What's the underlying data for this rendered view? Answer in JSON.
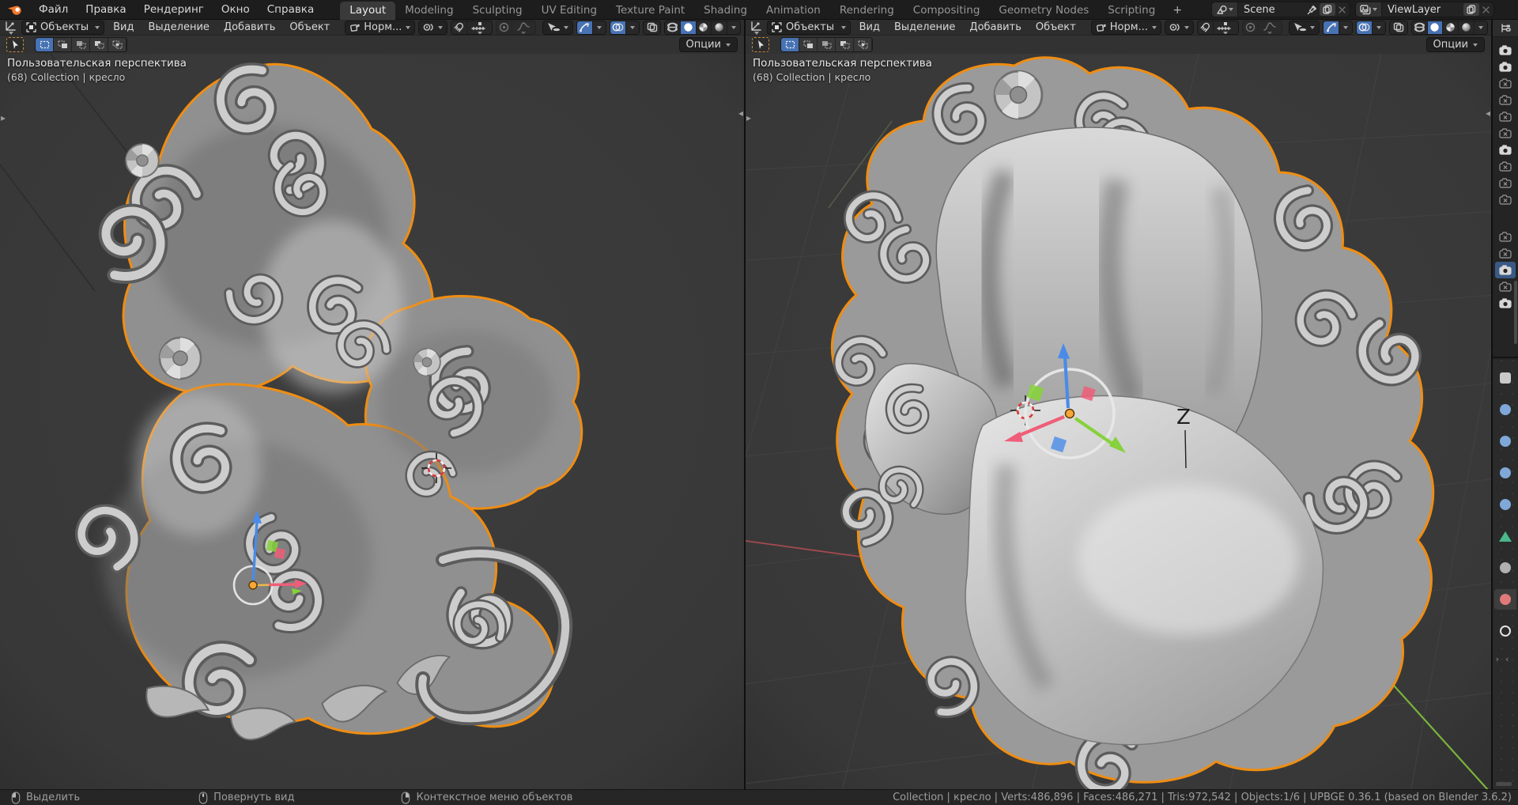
{
  "topbar": {
    "menus": [
      "Файл",
      "Правка",
      "Рендеринг",
      "Окно",
      "Справка"
    ],
    "tabs": [
      "Layout",
      "Modeling",
      "Sculpting",
      "UV Editing",
      "Texture Paint",
      "Shading",
      "Animation",
      "Rendering",
      "Compositing",
      "Geometry Nodes",
      "Scripting"
    ],
    "active_tab": "Layout",
    "add_workspace_label": "+",
    "scene_selector": {
      "value": "Scene"
    },
    "view_layer_selector": {
      "value": "ViewLayer"
    }
  },
  "viewport_header": {
    "mode": "Объекты",
    "menus": [
      "Вид",
      "Выделение",
      "Добавить",
      "Объект"
    ],
    "orientation": "Норм...",
    "options": "Опции"
  },
  "viewport_overlay": {
    "line1": "Пользовательская перспектива",
    "line2": "(68) Collection | кресло"
  },
  "right_viewport": {
    "axis_annotation": "Z"
  },
  "statusbar": {
    "hints": [
      {
        "mouse": "left",
        "label": "Выделить"
      },
      {
        "mouse": "middle",
        "label": "Повернуть вид"
      },
      {
        "mouse": "right",
        "label": "Контекстное меню объектов"
      }
    ],
    "info": "Collection | кресло | Verts:486,896 | Faces:486,271 | Tris:972,542 | Objects:1/6 | UPBGE 0.36.1 (based on Blender 3.6.2)"
  },
  "outliner": {
    "render_toggles": [
      "on",
      "on",
      "off",
      "off",
      "off",
      "off",
      "on",
      "off",
      "off",
      "off",
      "off",
      "off",
      "selected",
      "off",
      "on"
    ]
  },
  "properties_tabs": [
    {
      "name": "tool",
      "color": "#c9c9c9",
      "shape": "square",
      "active": false
    },
    {
      "name": "modifiers",
      "color": "#7fa8d9",
      "shape": "circle",
      "active": false
    },
    {
      "name": "particles",
      "color": "#7fa8d9",
      "shape": "circle",
      "active": false
    },
    {
      "name": "physics",
      "color": "#7fa8d9",
      "shape": "circle",
      "active": false
    },
    {
      "name": "constraints",
      "color": "#7fa8d9",
      "shape": "circle",
      "active": false
    },
    {
      "name": "object-data",
      "color": "#49b88a",
      "shape": "triangle",
      "active": false
    },
    {
      "name": "grease-pencil",
      "color": "#b0b0b0",
      "shape": "circle",
      "active": false
    },
    {
      "name": "material",
      "color": "#e07a7a",
      "shape": "circle",
      "active": true
    },
    {
      "name": "texture",
      "color": "#e4e4e4",
      "shape": "ring",
      "active": false
    }
  ],
  "colors": {
    "accent_blue": "#4772b3",
    "selection_outline": "#ef8d12",
    "axis_x": "#ef5e78",
    "axis_y": "#86d13c",
    "axis_z": "#4a8be8",
    "viewport_bg": "#3a3a3a",
    "topbar_bg": "#1d1d1d"
  }
}
